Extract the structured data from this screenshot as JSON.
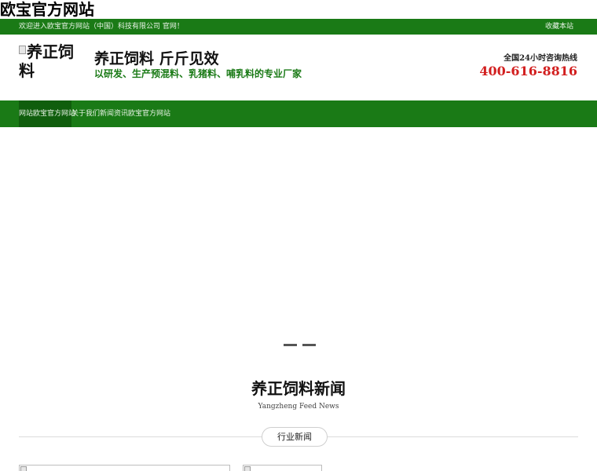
{
  "site": {
    "title": "欧宝官方网站"
  },
  "topbar": {
    "welcome": "欢迎进入欧宝官方网站（中国）科技有限公司 官网！",
    "bookmark": "收藏本站"
  },
  "header": {
    "logo_alt": "养正饲料",
    "slogan": "养正饲料 斤斤见效",
    "tagline": "以研发、生产预混料、乳猪料、哺乳料的专业厂家",
    "hotline_label": "全国24小时咨询热线",
    "hotline_phone": "400-616-8816"
  },
  "nav": {
    "home": "网站欧宝官方网站",
    "rest": "关于我们新闻资讯欧宝官方网站"
  },
  "news": {
    "title": "养正饲料新闻",
    "subtitle": "Yangzheng Feed News",
    "tab": "行业新闻"
  },
  "colors": {
    "brand_green": "#1a7a16",
    "hotline_red": "#d21f1f"
  }
}
